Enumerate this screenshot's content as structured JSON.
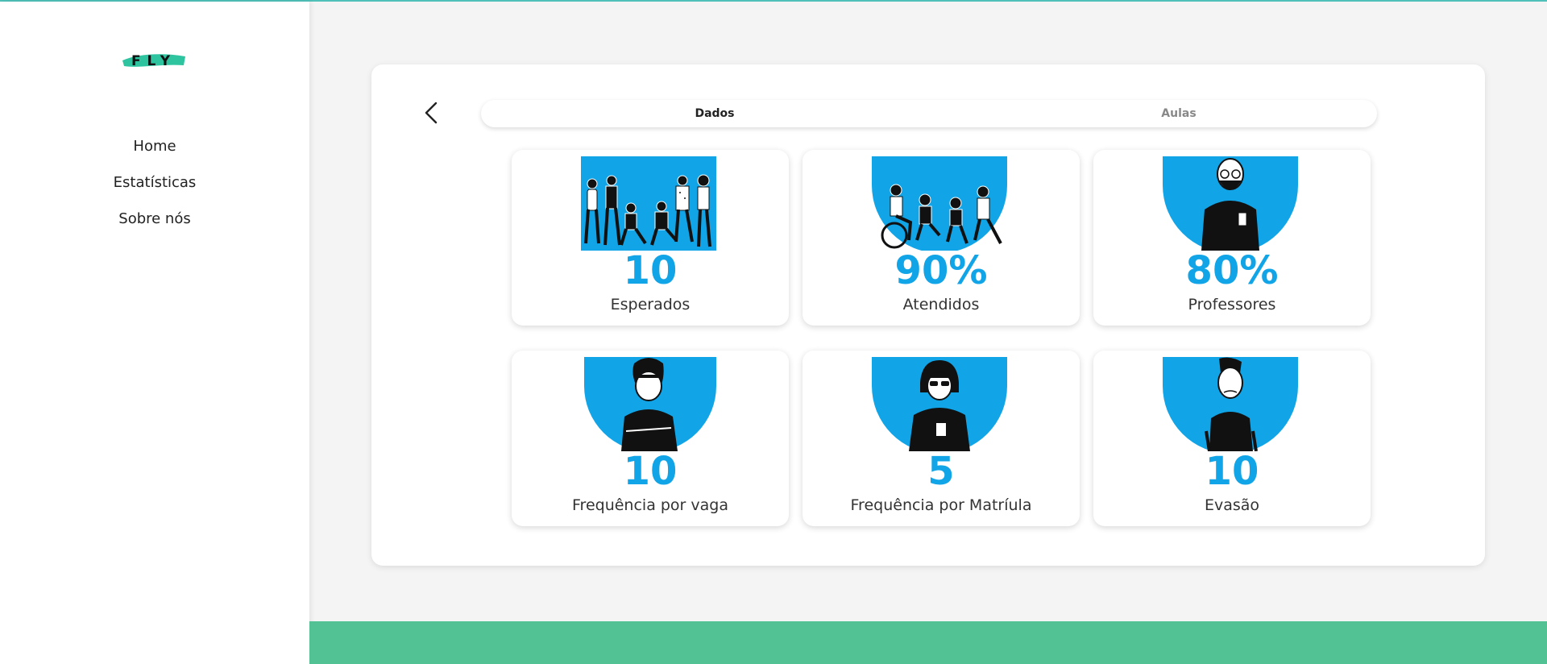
{
  "app": {
    "logo_text": "FLY"
  },
  "colors": {
    "accent": "#11a5e8",
    "brand": "#2ec4a0",
    "footer": "#52c194"
  },
  "sidebar": {
    "items": [
      {
        "label": "Home"
      },
      {
        "label": "Estatísticas"
      },
      {
        "label": "Sobre nós"
      }
    ]
  },
  "tabs": [
    {
      "label": "Dados"
    },
    {
      "label": "Aulas"
    }
  ],
  "cards": [
    {
      "value": "10",
      "label": "Esperados",
      "icon": "group-of-people-illustration"
    },
    {
      "value": "90%",
      "label": "Atendidos",
      "icon": "people-sitting-illustration"
    },
    {
      "value": "80%",
      "label": "Professores",
      "icon": "teacher-illustration"
    },
    {
      "value": "10",
      "label": "Frequência por vaga",
      "icon": "student-arms-crossed-illustration"
    },
    {
      "value": "5",
      "label": "Frequência por Matríula",
      "icon": "student-sunglasses-illustration"
    },
    {
      "value": "10",
      "label": "Evasão",
      "icon": "student-sad-illustration"
    }
  ]
}
